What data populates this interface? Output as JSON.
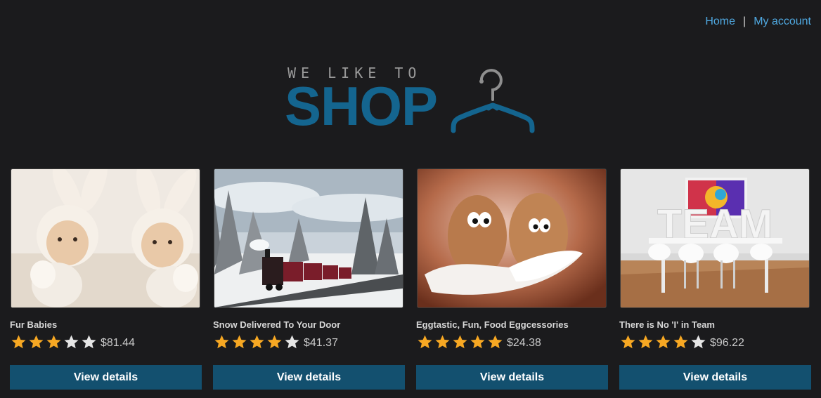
{
  "nav": {
    "home_label": "Home",
    "separator": "|",
    "account_label": "My account"
  },
  "logo": {
    "tagline": "WE LIKE TO",
    "word": "SHOP",
    "icon": "hanger-icon"
  },
  "colors": {
    "background": "#1b1b1d",
    "link": "#4fa8e0",
    "brand": "#14658f",
    "button": "#13506f",
    "star_filled": "#f7a823",
    "star_empty": "#e6e6e6"
  },
  "products": [
    {
      "title": "Fur Babies",
      "rating": 3,
      "max_rating": 5,
      "price": "$81.44",
      "button_label": "View details",
      "image": "twin-babies-in-bunny-hoods-photo"
    },
    {
      "title": "Snow Delivered To Your Door",
      "rating": 4,
      "max_rating": 5,
      "price": "$41.37",
      "button_label": "View details",
      "image": "steam-train-in-snowy-forest-photo"
    },
    {
      "title": "Eggtastic, Fun, Food Eggcessories",
      "rating": 5,
      "max_rating": 5,
      "price": "$24.38",
      "button_label": "View details",
      "image": "eggs-with-googly-eyes-on-feathers-photo"
    },
    {
      "title": "There is No 'I' in Team",
      "rating": 4,
      "max_rating": 5,
      "price": "$96.22",
      "button_label": "View details",
      "image": "team-letters-on-meeting-table-photo"
    }
  ]
}
